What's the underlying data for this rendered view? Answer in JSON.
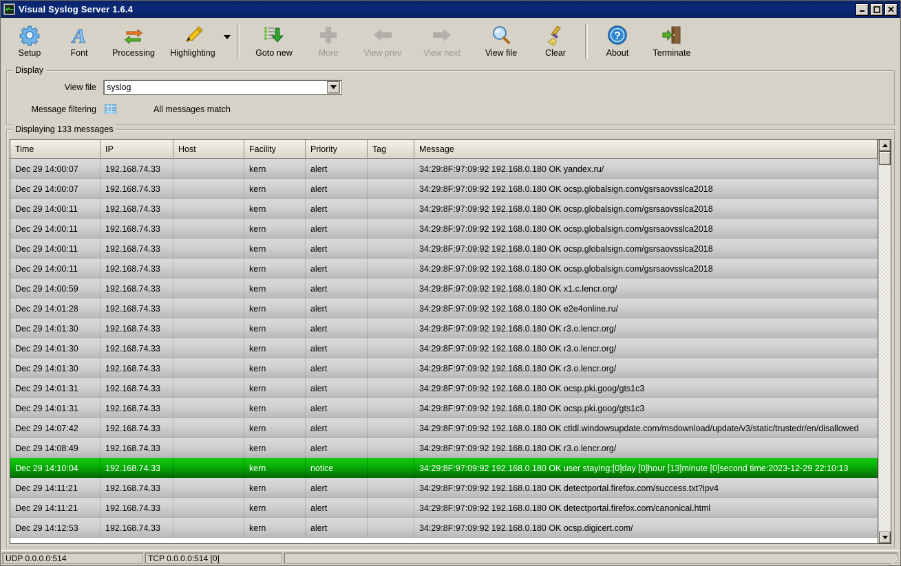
{
  "window": {
    "title": "Visual Syslog Server 1.6.4",
    "app_icon": "syslog-waveform-icon",
    "buttons": {
      "minimize": "_",
      "maximize": "❐",
      "close": "✕"
    }
  },
  "toolbar": {
    "items": [
      {
        "label": "Setup",
        "icon": "gear-icon",
        "enabled": true
      },
      {
        "label": "Font",
        "icon": "font-a-icon",
        "enabled": true
      },
      {
        "label": "Processing",
        "icon": "refresh-arrows-icon",
        "enabled": true
      },
      {
        "label": "Highlighting",
        "icon": "highlighter-pen-icon",
        "enabled": true
      },
      {
        "label": "Goto new",
        "icon": "goto-new-down-arrow-icon",
        "enabled": true
      },
      {
        "label": "More",
        "icon": "plus-icon",
        "enabled": false
      },
      {
        "label": "View prev",
        "icon": "arrow-left-icon",
        "enabled": false
      },
      {
        "label": "View next",
        "icon": "arrow-right-icon",
        "enabled": false
      },
      {
        "label": "View file",
        "icon": "magnifier-icon",
        "enabled": true
      },
      {
        "label": "Clear",
        "icon": "broom-icon",
        "enabled": true
      },
      {
        "label": "About",
        "icon": "question-circle-icon",
        "enabled": true
      },
      {
        "label": "Terminate",
        "icon": "exit-door-icon",
        "enabled": true
      }
    ],
    "highlighting_dropdown": "chevron-down-icon"
  },
  "display": {
    "group_title": "Display",
    "view_file_label": "View file",
    "view_file_value": "syslog",
    "view_file_placeholder": "syslog",
    "message_filtering_label": "Message filtering",
    "filter_icon": "filter-grid-icon",
    "filter_status": "All messages match"
  },
  "list": {
    "group_title": "Displaying 133 messages",
    "columns": [
      "Time",
      "IP",
      "Host",
      "Facility",
      "Priority",
      "Tag",
      "Message"
    ],
    "rows": [
      {
        "time": "Dec 29 14:00:07",
        "ip": "192.168.74.33",
        "host": "",
        "facility": "kern",
        "priority": "alert",
        "tag": "",
        "message": "34:29:8F:97:09:92 192.168.0.180  OK yandex.ru/",
        "selected": false
      },
      {
        "time": "Dec 29 14:00:07",
        "ip": "192.168.74.33",
        "host": "",
        "facility": "kern",
        "priority": "alert",
        "tag": "",
        "message": "34:29:8F:97:09:92 192.168.0.180  OK ocsp.globalsign.com/gsrsaovsslca2018",
        "selected": false
      },
      {
        "time": "Dec 29 14:00:11",
        "ip": "192.168.74.33",
        "host": "",
        "facility": "kern",
        "priority": "alert",
        "tag": "",
        "message": "34:29:8F:97:09:92 192.168.0.180  OK ocsp.globalsign.com/gsrsaovsslca2018",
        "selected": false
      },
      {
        "time": "Dec 29 14:00:11",
        "ip": "192.168.74.33",
        "host": "",
        "facility": "kern",
        "priority": "alert",
        "tag": "",
        "message": "34:29:8F:97:09:92 192.168.0.180  OK ocsp.globalsign.com/gsrsaovsslca2018",
        "selected": false
      },
      {
        "time": "Dec 29 14:00:11",
        "ip": "192.168.74.33",
        "host": "",
        "facility": "kern",
        "priority": "alert",
        "tag": "",
        "message": "34:29:8F:97:09:92 192.168.0.180  OK ocsp.globalsign.com/gsrsaovsslca2018",
        "selected": false
      },
      {
        "time": "Dec 29 14:00:11",
        "ip": "192.168.74.33",
        "host": "",
        "facility": "kern",
        "priority": "alert",
        "tag": "",
        "message": "34:29:8F:97:09:92 192.168.0.180  OK ocsp.globalsign.com/gsrsaovsslca2018",
        "selected": false
      },
      {
        "time": "Dec 29 14:00:59",
        "ip": "192.168.74.33",
        "host": "",
        "facility": "kern",
        "priority": "alert",
        "tag": "",
        "message": "34:29:8F:97:09:92 192.168.0.180  OK x1.c.lencr.org/",
        "selected": false
      },
      {
        "time": "Dec 29 14:01:28",
        "ip": "192.168.74.33",
        "host": "",
        "facility": "kern",
        "priority": "alert",
        "tag": "",
        "message": "34:29:8F:97:09:92 192.168.0.180  OK e2e4online.ru/",
        "selected": false
      },
      {
        "time": "Dec 29 14:01:30",
        "ip": "192.168.74.33",
        "host": "",
        "facility": "kern",
        "priority": "alert",
        "tag": "",
        "message": "34:29:8F:97:09:92 192.168.0.180  OK r3.o.lencr.org/",
        "selected": false
      },
      {
        "time": "Dec 29 14:01:30",
        "ip": "192.168.74.33",
        "host": "",
        "facility": "kern",
        "priority": "alert",
        "tag": "",
        "message": "34:29:8F:97:09:92 192.168.0.180  OK r3.o.lencr.org/",
        "selected": false
      },
      {
        "time": "Dec 29 14:01:30",
        "ip": "192.168.74.33",
        "host": "",
        "facility": "kern",
        "priority": "alert",
        "tag": "",
        "message": "34:29:8F:97:09:92 192.168.0.180  OK r3.o.lencr.org/",
        "selected": false
      },
      {
        "time": "Dec 29 14:01:31",
        "ip": "192.168.74.33",
        "host": "",
        "facility": "kern",
        "priority": "alert",
        "tag": "",
        "message": "34:29:8F:97:09:92 192.168.0.180  OK ocsp.pki.goog/gts1c3",
        "selected": false
      },
      {
        "time": "Dec 29 14:01:31",
        "ip": "192.168.74.33",
        "host": "",
        "facility": "kern",
        "priority": "alert",
        "tag": "",
        "message": "34:29:8F:97:09:92 192.168.0.180  OK ocsp.pki.goog/gts1c3",
        "selected": false
      },
      {
        "time": "Dec 29 14:07:42",
        "ip": "192.168.74.33",
        "host": "",
        "facility": "kern",
        "priority": "alert",
        "tag": "",
        "message": "34:29:8F:97:09:92 192.168.0.180  OK ctldl.windowsupdate.com/msdownload/update/v3/static/trustedr/en/disallowed",
        "selected": false
      },
      {
        "time": "Dec 29 14:08:49",
        "ip": "192.168.74.33",
        "host": "",
        "facility": "kern",
        "priority": "alert",
        "tag": "",
        "message": "34:29:8F:97:09:92 192.168.0.180  OK r3.o.lencr.org/",
        "selected": false
      },
      {
        "time": "Dec 29 14:10:04",
        "ip": "192.168.74.33",
        "host": "",
        "facility": "kern",
        "priority": "notice",
        "tag": "",
        "message": "34:29:8F:97:09:92 192.168.0.180 OK user staying:[0]day [0]hour [13]minute [0]second time:2023-12-29 22:10:13",
        "selected": true
      },
      {
        "time": "Dec 29 14:11:21",
        "ip": "192.168.74.33",
        "host": "",
        "facility": "kern",
        "priority": "alert",
        "tag": "",
        "message": "34:29:8F:97:09:92 192.168.0.180  OK detectportal.firefox.com/success.txt?ipv4",
        "selected": false
      },
      {
        "time": "Dec 29 14:11:21",
        "ip": "192.168.74.33",
        "host": "",
        "facility": "kern",
        "priority": "alert",
        "tag": "",
        "message": "34:29:8F:97:09:92 192.168.0.180  OK detectportal.firefox.com/canonical.html",
        "selected": false
      },
      {
        "time": "Dec 29 14:12:53",
        "ip": "192.168.74.33",
        "host": "",
        "facility": "kern",
        "priority": "alert",
        "tag": "",
        "message": "34:29:8F:97:09:92 192.168.0.180  OK ocsp.digicert.com/",
        "selected": false
      }
    ],
    "scrollbar": {
      "up": "scroll-up-icon",
      "down": "scroll-down-icon"
    }
  },
  "statusbar": {
    "udp": "UDP 0.0.0.0:514",
    "tcp": "TCP 0.0.0.0:514 [0]",
    "extra": ""
  },
  "colors": {
    "titlebar": "#0a246a",
    "selected_row": "#00b400",
    "window_face": "#d6d2c8"
  }
}
